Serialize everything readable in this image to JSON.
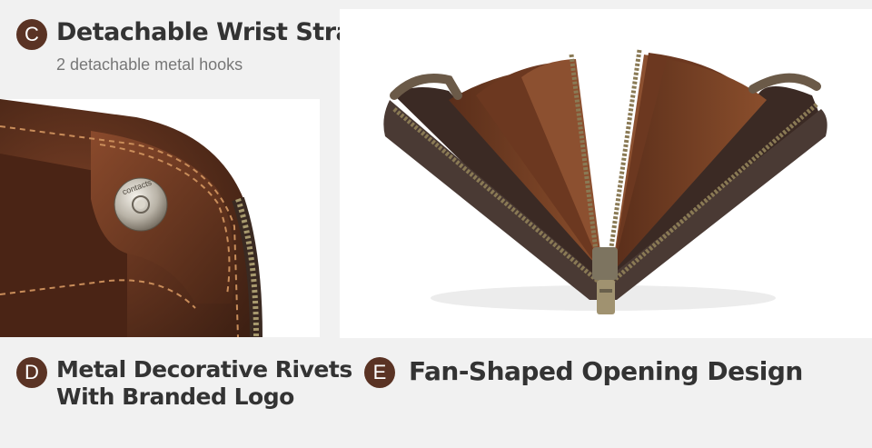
{
  "features": [
    {
      "badge": "C",
      "title": "Detachable Wrist Strap",
      "subtitle": "2 detachable metal hooks"
    },
    {
      "badge": "D",
      "title_line1": "Metal Decorative Rivets",
      "title_line2": "With Branded Logo"
    },
    {
      "badge": "E",
      "title": "Fan-Shaped Opening Design"
    }
  ],
  "photos": {
    "rivet_closeup": {
      "logo_text": "contacts"
    },
    "fan_wallet": {}
  },
  "colors": {
    "badge": "#5a3324",
    "leather": "#6b3a22",
    "zipper": "#8a7a55",
    "background": "#f1f1f1"
  }
}
